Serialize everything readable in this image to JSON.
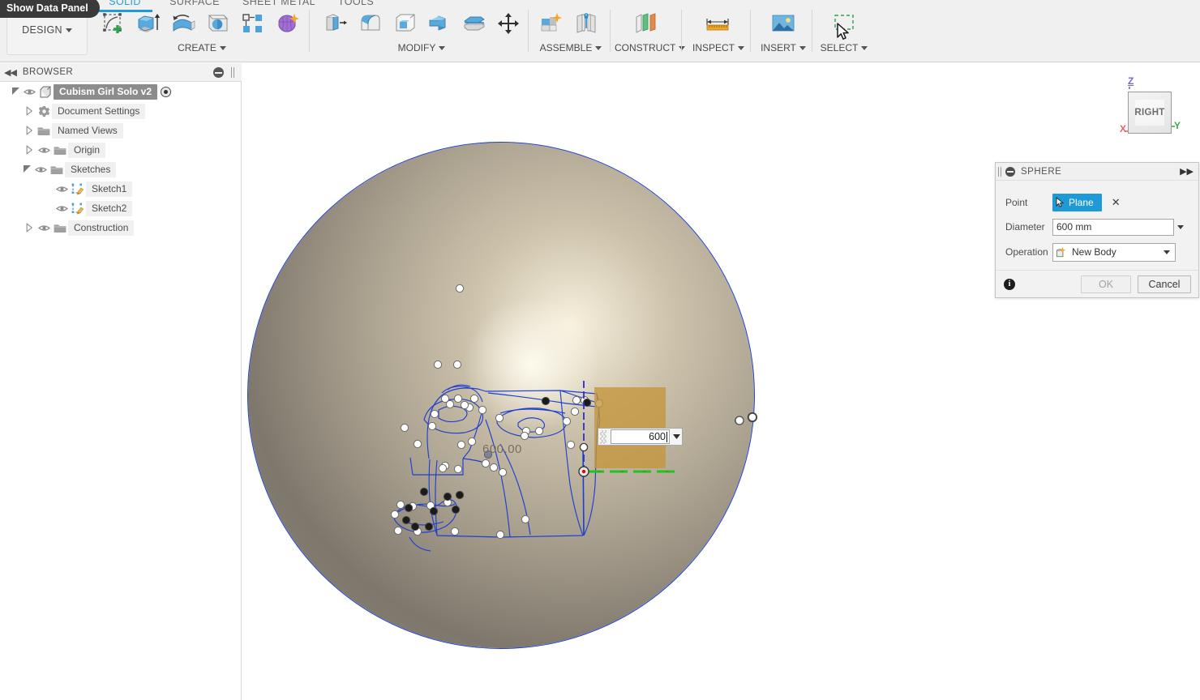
{
  "app": {
    "data_panel_tooltip": "Show Data Panel",
    "workspace": "DESIGN"
  },
  "ribbon": {
    "tabs": [
      {
        "label": "SOLID",
        "active": true
      },
      {
        "label": "SURFACE",
        "active": false
      },
      {
        "label": "SHEET METAL",
        "active": false
      },
      {
        "label": "TOOLS",
        "active": false
      }
    ],
    "groups": [
      {
        "title": "CREATE",
        "has_caret": true
      },
      {
        "title": "MODIFY",
        "has_caret": true
      },
      {
        "title": "ASSEMBLE",
        "has_caret": true
      },
      {
        "title": "CONSTRUCT",
        "has_caret": true
      },
      {
        "title": "INSPECT",
        "has_caret": true
      },
      {
        "title": "INSERT",
        "has_caret": true
      },
      {
        "title": "SELECT",
        "has_caret": true
      }
    ],
    "icons": {
      "create": [
        "create-sketch-icon",
        "extrude-icon",
        "revolve-icon",
        "sphere-icon",
        "pattern-icon",
        "form-icon"
      ],
      "modify": [
        "press-pull-icon",
        "fillet-icon",
        "shell-icon",
        "combine-icon",
        "split-face-icon",
        "move-copy-icon"
      ],
      "assemble": [
        "new-component-icon",
        "joint-icon"
      ],
      "construct": [
        "offset-plane-icon"
      ],
      "inspect": [
        "measure-icon"
      ],
      "insert": [
        "insert-mesh-icon"
      ],
      "select": [
        "select-window-icon"
      ]
    }
  },
  "browser": {
    "title": "BROWSER",
    "collapse_icon": "collapse-left-icon",
    "minimize_icon": "minimize-icon",
    "grip_icon": "grip-icon",
    "items": [
      {
        "label": "Cubism Girl Solo v2",
        "depth": 0,
        "expander": "open",
        "eye": true,
        "icon": "component-icon",
        "selected": true,
        "radio": true
      },
      {
        "label": "Document Settings",
        "depth": 1,
        "expander": "closed",
        "eye": false,
        "icon": "gear-icon",
        "selected": false,
        "radio": false
      },
      {
        "label": "Named Views",
        "depth": 1,
        "expander": "closed",
        "eye": false,
        "icon": "folder-icon",
        "selected": false,
        "radio": false
      },
      {
        "label": "Origin",
        "depth": 1,
        "expander": "closed",
        "eye": true,
        "icon": "folder-icon",
        "selected": false,
        "radio": false
      },
      {
        "label": "Sketches",
        "depth": 1,
        "expander": "open",
        "eye": true,
        "icon": "folder-icon",
        "selected": false,
        "radio": false
      },
      {
        "label": "Sketch1",
        "depth": 2,
        "expander": "none",
        "eye": true,
        "icon": "sketch-icon",
        "selected": false,
        "radio": false
      },
      {
        "label": "Sketch2",
        "depth": 2,
        "expander": "none",
        "eye": true,
        "icon": "sketch-icon",
        "selected": false,
        "radio": false
      },
      {
        "label": "Construction",
        "depth": 1,
        "expander": "closed",
        "eye": true,
        "icon": "folder-icon",
        "selected": false,
        "radio": false
      }
    ]
  },
  "viewport": {
    "dimension_label": "600.00",
    "inline_value": "600",
    "inline_dropdown_icon": "chevron-down-icon",
    "inline_grip_icon": "drag-grip-icon",
    "body_name": "sphere-preview",
    "plane_name": "construction-plane-preview",
    "axis_name": "y-axis-green",
    "origin_name": "origin-point",
    "cursor_icon": "mouse-cursor"
  },
  "viewcube": {
    "face_label": "RIGHT",
    "axes": [
      {
        "label": "Z",
        "color": "#6b6bd6"
      },
      {
        "label": "X",
        "color": "#e06666"
      },
      {
        "label": "Y",
        "color": "#3aab4a"
      }
    ]
  },
  "dialog": {
    "title": "SPHERE",
    "minimize_icon": "minimize-icon",
    "expand_icon": "expand-right-icon",
    "grip_icon": "grip-icon",
    "fields": [
      {
        "label": "Point",
        "type": "select-button",
        "value": "Plane",
        "icon": "cursor-select-icon",
        "clear_icon": "close-x-icon"
      },
      {
        "label": "Diameter",
        "type": "text",
        "value": "600 mm",
        "dropdown_icon": "chevron-down-icon"
      },
      {
        "label": "Operation",
        "type": "combo",
        "value": "New Body",
        "icon": "new-body-icon",
        "dropdown_icon": "chevron-down-icon"
      }
    ],
    "footer": {
      "info_icon": "info-icon",
      "info_glyph": "i",
      "ok_label": "OK",
      "ok_disabled": true,
      "cancel_label": "Cancel"
    }
  },
  "colors": {
    "accent": "#1e9bd7",
    "sketch_line": "#1e3fd1",
    "plane": "#c4963e",
    "axis_green": "#26c426",
    "selected_row": "#8c8c8c"
  }
}
